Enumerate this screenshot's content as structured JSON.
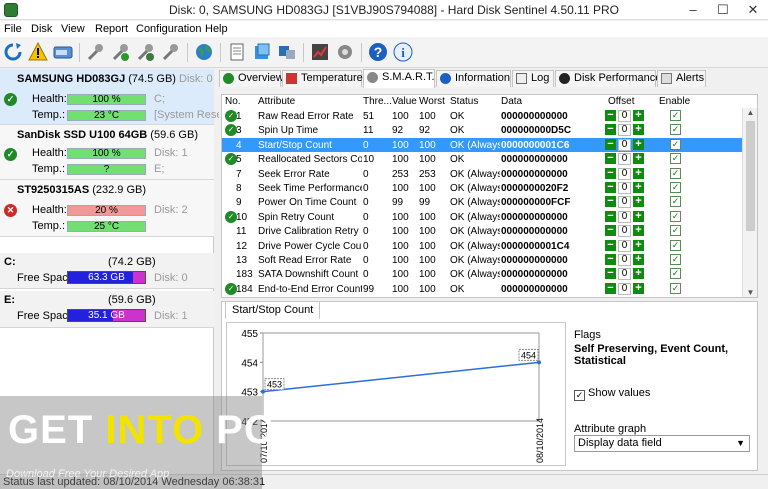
{
  "window": {
    "title": "Disk: 0, SAMSUNG HD083GJ [S1VBJ90S794088]  -  Hard Disk Sentinel 4.50.11 PRO",
    "minimize": "–",
    "maximize": "☐",
    "close": "✕"
  },
  "menu": [
    "File",
    "Disk",
    "View",
    "Report",
    "Configuration",
    "Help"
  ],
  "toolbar": {
    "icons": [
      "refresh-icon",
      "warning-icon",
      "drive-icon",
      "wrench-icon",
      "wrench-check-icon",
      "wrench-gear-icon",
      "wrench-arrow-icon",
      "globe-icon",
      "document-icon",
      "cube-icon",
      "puzzle-icon",
      "chart-icon",
      "gear-icon",
      "help-icon",
      "info-icon"
    ]
  },
  "disks": [
    {
      "name": "SAMSUNG HD083GJ",
      "size": "(74.5 GB)",
      "disk_id": "Disk: 0",
      "status": "ok",
      "health_label": "Health:",
      "health": "100 %",
      "health_pct": 100,
      "health_note": "C;",
      "temp_label": "Temp.:",
      "temp": "23 °C",
      "temp_note": "[System Rese"
    },
    {
      "name": "SanDisk SSD U100 64GB",
      "size": "(59.6 GB)",
      "disk_id": "",
      "status": "ok",
      "health_label": "Health:",
      "health": "100 %",
      "health_pct": 100,
      "health_note": "Disk: 1",
      "temp_label": "Temp.:",
      "temp": "?",
      "temp_note": "E;"
    },
    {
      "name": "ST9250315AS",
      "size": "(232.9 GB)",
      "disk_id": "",
      "status": "bad",
      "health_label": "Health:",
      "health": "20 %",
      "health_pct": 20,
      "health_note": "Disk: 2",
      "temp_label": "Temp.:",
      "temp": "25 °C",
      "temp_note": ""
    }
  ],
  "partitions": [
    {
      "label": "C:",
      "size": "(74.2 GB)",
      "free_label": "Free Space",
      "free": "63.3 GB",
      "free_pct": 85,
      "disk": "Disk: 0"
    },
    {
      "label": "E:",
      "size": "(59.6 GB)",
      "free_label": "Free Space",
      "free": "35.1 GB",
      "free_pct": 59,
      "disk": "Disk: 1"
    }
  ],
  "tabs": [
    "Overview",
    "Temperature",
    "S.M.A.R.T.",
    "Information",
    "Log",
    "Disk Performance",
    "Alerts"
  ],
  "active_tab": "S.M.A.R.T.",
  "smart": {
    "headers": {
      "no": "No.",
      "attribute": "Attribute",
      "threshold": "Thre...",
      "value": "Value",
      "worst": "Worst",
      "status": "Status",
      "data": "Data",
      "offset": "Offset",
      "enable": "Enable"
    },
    "rows": [
      {
        "no": "1",
        "attr": "Raw Read Error Rate",
        "thr": "51",
        "val": "100",
        "worst": "100",
        "status": "OK",
        "data": "000000000000",
        "offset": "0",
        "icon": true
      },
      {
        "no": "3",
        "attr": "Spin Up Time",
        "thr": "11",
        "val": "92",
        "worst": "92",
        "status": "OK",
        "data": "000000000D5C",
        "offset": "0",
        "icon": true
      },
      {
        "no": "4",
        "attr": "Start/Stop Count",
        "thr": "0",
        "val": "100",
        "worst": "100",
        "status": "OK (Always...",
        "data": "0000000001C6",
        "offset": "0",
        "icon": false,
        "selected": true
      },
      {
        "no": "5",
        "attr": "Reallocated Sectors Co...",
        "thr": "10",
        "val": "100",
        "worst": "100",
        "status": "OK",
        "data": "000000000000",
        "offset": "0",
        "icon": true
      },
      {
        "no": "7",
        "attr": "Seek Error Rate",
        "thr": "0",
        "val": "253",
        "worst": "253",
        "status": "OK (Always...",
        "data": "000000000000",
        "offset": "0",
        "icon": false
      },
      {
        "no": "8",
        "attr": "Seek Time Performance",
        "thr": "0",
        "val": "100",
        "worst": "100",
        "status": "OK (Always...",
        "data": "0000000020F2",
        "offset": "0",
        "icon": false
      },
      {
        "no": "9",
        "attr": "Power On Time Count",
        "thr": "0",
        "val": "99",
        "worst": "99",
        "status": "OK (Always...",
        "data": "000000000FCF",
        "offset": "0",
        "icon": false
      },
      {
        "no": "10",
        "attr": "Spin Retry Count",
        "thr": "0",
        "val": "100",
        "worst": "100",
        "status": "OK (Always...",
        "data": "000000000000",
        "offset": "0",
        "icon": true
      },
      {
        "no": "11",
        "attr": "Drive Calibration Retry ...",
        "thr": "0",
        "val": "100",
        "worst": "100",
        "status": "OK (Always...",
        "data": "000000000000",
        "offset": "0",
        "icon": false
      },
      {
        "no": "12",
        "attr": "Drive Power Cycle Count",
        "thr": "0",
        "val": "100",
        "worst": "100",
        "status": "OK (Always...",
        "data": "0000000001C4",
        "offset": "0",
        "icon": false
      },
      {
        "no": "13",
        "attr": "Soft Read Error Rate",
        "thr": "0",
        "val": "100",
        "worst": "100",
        "status": "OK (Always...",
        "data": "000000000000",
        "offset": "0",
        "icon": false
      },
      {
        "no": "183",
        "attr": "SATA Downshift Count",
        "thr": "0",
        "val": "100",
        "worst": "100",
        "status": "OK (Always...",
        "data": "000000000000",
        "offset": "0",
        "icon": false
      },
      {
        "no": "184",
        "attr": "End-to-End Error Count",
        "thr": "99",
        "val": "100",
        "worst": "100",
        "status": "OK",
        "data": "000000000000",
        "offset": "0",
        "icon": true
      }
    ]
  },
  "graph": {
    "tab": "Start/Stop Count",
    "chart_data": {
      "type": "line",
      "x": [
        "07/10/2014",
        "08/10/2014"
      ],
      "values": [
        453,
        454
      ],
      "ylim": [
        452,
        455
      ],
      "yticks": [
        "455",
        "454",
        "453",
        "452"
      ]
    },
    "flags_label": "Flags",
    "flags_value": "Self Preserving, Event Count, Statistical",
    "show_values_label": "Show values",
    "attr_graph_label": "Attribute graph",
    "attr_graph_value": "Display data field"
  },
  "status": "Status last updated: 08/10/2014 Wednesday 06:38:31",
  "watermark": {
    "line1a": "GET ",
    "line1b": "INTO",
    "line1c": " PC",
    "line2": "Download Free Your Desired App"
  }
}
